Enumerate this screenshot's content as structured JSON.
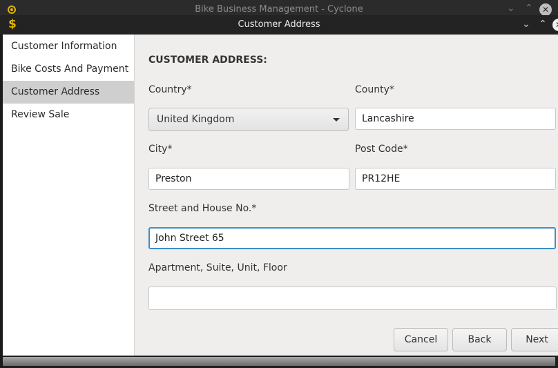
{
  "parent_window": {
    "title": "Bike Business Management - Cyclone"
  },
  "dialog": {
    "title": "Customer Address"
  },
  "sidebar": {
    "items": [
      {
        "label": "Customer Information"
      },
      {
        "label": "Bike Costs And Payment"
      },
      {
        "label": "Customer Address",
        "active": true
      },
      {
        "label": "Review Sale"
      }
    ]
  },
  "form": {
    "section_title": "CUSTOMER ADDRESS:",
    "country": {
      "label": "Country*",
      "value": "United Kingdom"
    },
    "county": {
      "label": "County*",
      "value": "Lancashire"
    },
    "city": {
      "label": "City*",
      "value": "Preston"
    },
    "post_code": {
      "label": "Post Code*",
      "value": "PR12HE"
    },
    "street": {
      "label": "Street and House No.*",
      "value": "John Street 65"
    },
    "apartment": {
      "label": "Apartment, Suite, Unit, Floor",
      "value": ""
    }
  },
  "buttons": {
    "cancel": "Cancel",
    "back": "Back",
    "next": "Next"
  },
  "colors": {
    "focus": "#3d8ec9",
    "accent": "#e3b400"
  }
}
